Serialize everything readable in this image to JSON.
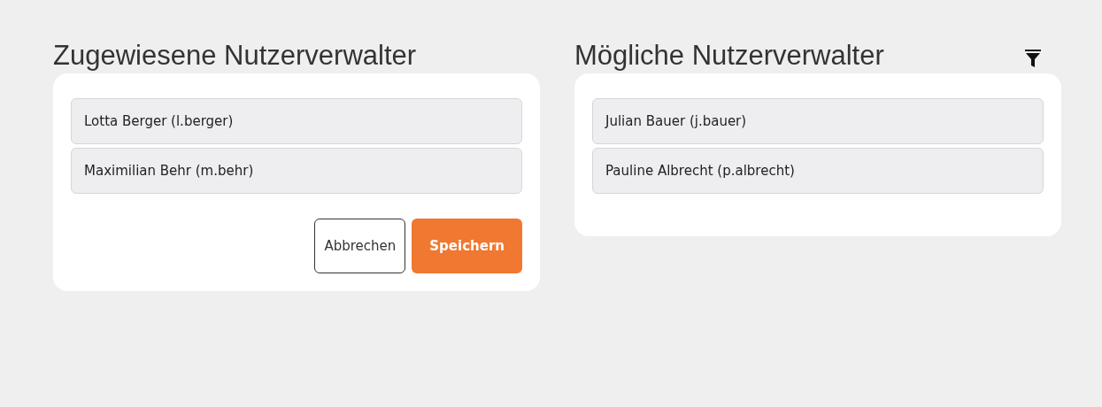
{
  "assigned": {
    "title": "Zugewiesene Nutzerverwalter",
    "items": [
      {
        "label": "Lotta Berger (l.berger)"
      },
      {
        "label": "Maximilian Behr (m.behr)"
      }
    ],
    "buttons": [
      {
        "label": "Abbrechen",
        "kind": "secondary"
      },
      {
        "label": "Speichern",
        "kind": "primary"
      }
    ]
  },
  "possible": {
    "title": "Mögliche Nutzerverwalter",
    "filter": true,
    "items": [
      {
        "label": "Julian Bauer (j.bauer)"
      },
      {
        "label": "Pauline Albrecht (p.albrecht)"
      }
    ]
  }
}
